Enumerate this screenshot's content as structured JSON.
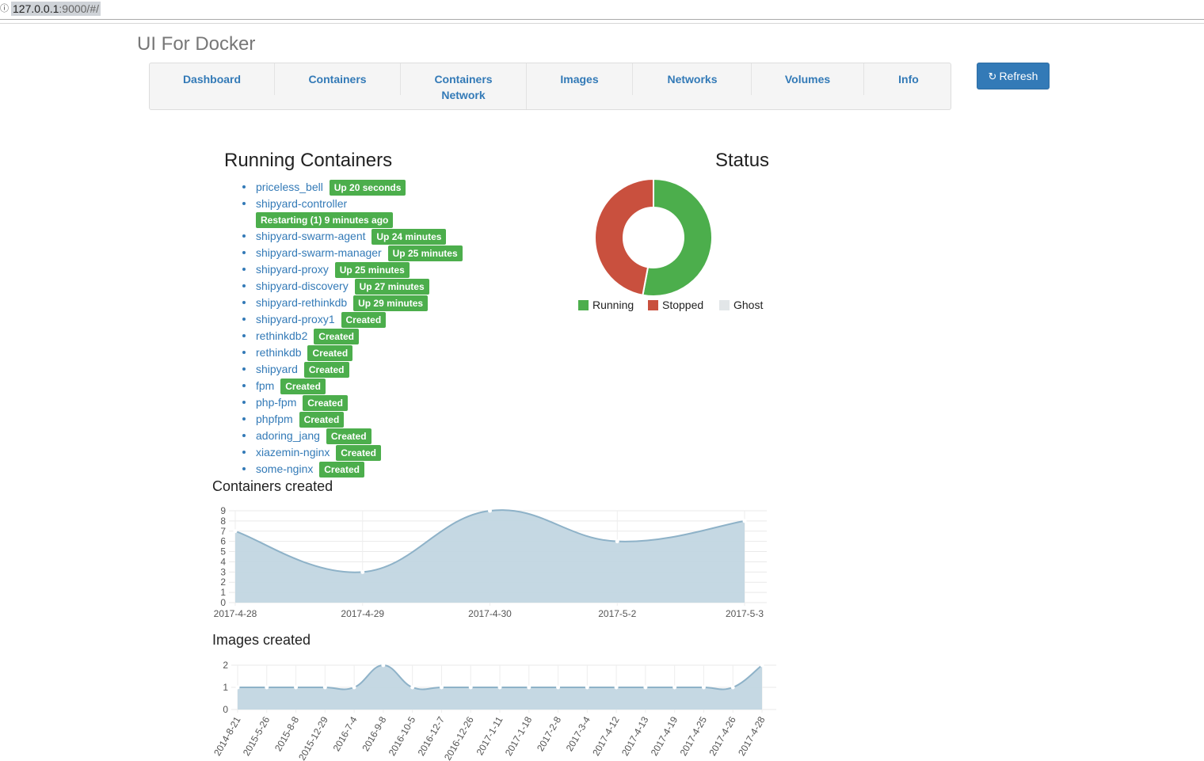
{
  "browser": {
    "url_host": "127.0.0.1",
    "url_rest": ":9000/#/"
  },
  "app": {
    "title": "UI For Docker"
  },
  "nav": {
    "items": [
      {
        "label": "Dashboard"
      },
      {
        "label": "Containers"
      },
      {
        "label": "Containers Network"
      },
      {
        "label": "Images"
      },
      {
        "label": "Networks"
      },
      {
        "label": "Volumes"
      },
      {
        "label": "Info"
      }
    ],
    "refresh_label": "Refresh"
  },
  "running": {
    "title": "Running Containers",
    "containers": [
      {
        "name": "priceless_bell",
        "status": "Up 20 seconds"
      },
      {
        "name": "shipyard-controller",
        "status": "Restarting (1) 9 minutes ago"
      },
      {
        "name": "shipyard-swarm-agent",
        "status": "Up 24 minutes"
      },
      {
        "name": "shipyard-swarm-manager",
        "status": "Up 25 minutes"
      },
      {
        "name": "shipyard-proxy",
        "status": "Up 25 minutes"
      },
      {
        "name": "shipyard-discovery",
        "status": "Up 27 minutes"
      },
      {
        "name": "shipyard-rethinkdb",
        "status": "Up 29 minutes"
      },
      {
        "name": "shipyard-proxy1",
        "status": "Created"
      },
      {
        "name": "rethinkdb2",
        "status": "Created"
      },
      {
        "name": "rethinkdb",
        "status": "Created"
      },
      {
        "name": "shipyard",
        "status": "Created"
      },
      {
        "name": "fpm",
        "status": "Created"
      },
      {
        "name": "php-fpm",
        "status": "Created"
      },
      {
        "name": "phpfpm",
        "status": "Created"
      },
      {
        "name": "adoring_jang",
        "status": "Created"
      },
      {
        "name": "xiazemin-nginx",
        "status": "Created"
      },
      {
        "name": "some-nginx",
        "status": "Created"
      }
    ]
  },
  "colors": {
    "running": "#4cae4c",
    "stopped": "#c9503e",
    "ghost": "#e2e6e8",
    "area_fill": "#c2d6e2",
    "area_line": "#8eb2c8"
  },
  "chart_data": [
    {
      "type": "pie",
      "title": "Status",
      "labels": [
        "Running",
        "Stopped",
        "Ghost"
      ],
      "values": [
        9,
        8,
        0
      ]
    },
    {
      "type": "area",
      "title": "Containers created",
      "x": [
        "2017-4-28",
        "2017-4-29",
        "2017-4-30",
        "2017-5-2",
        "2017-5-3"
      ],
      "values": [
        7,
        3,
        9,
        6,
        8
      ],
      "ylim": [
        0,
        9
      ],
      "yticks": [
        "0",
        "1",
        "2",
        "3",
        "4",
        "5",
        "6",
        "7",
        "8",
        "9"
      ],
      "grid": true
    },
    {
      "type": "area",
      "title": "Images created",
      "x": [
        "2014-8-21",
        "2015-5-26",
        "2015-8-8",
        "2015-12-29",
        "2016-7-4",
        "2016-9-8",
        "2016-10-5",
        "2016-12-7",
        "2016-12-26",
        "2017-1-11",
        "2017-1-18",
        "2017-2-8",
        "2017-3-4",
        "2017-4-12",
        "2017-4-13",
        "2017-4-19",
        "2017-4-25",
        "2017-4-26",
        "2017-4-28"
      ],
      "values": [
        1,
        1,
        1,
        1,
        1,
        2,
        1,
        1,
        1,
        1,
        1,
        1,
        1,
        1,
        1,
        1,
        1,
        1,
        2
      ],
      "ylim": [
        0,
        2
      ],
      "yticks": [
        "0",
        "1",
        "2"
      ],
      "grid": true
    }
  ]
}
